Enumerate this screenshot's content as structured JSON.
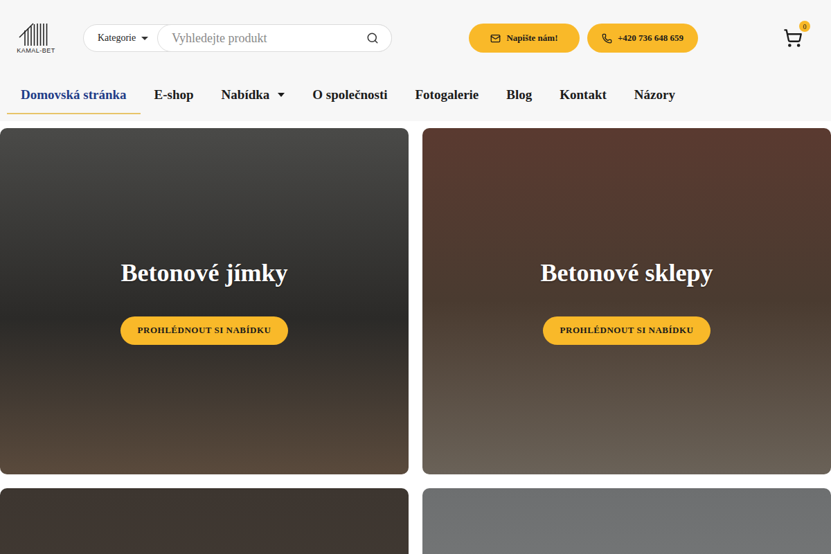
{
  "logo": {
    "text": "KAMAL-BET"
  },
  "search": {
    "category": "Kategorie",
    "placeholder": "Vyhledejte produkt"
  },
  "header_buttons": [
    {
      "label": "Napište nám!",
      "kind": "mail"
    },
    {
      "label": "+420 736 648 659",
      "kind": "phone"
    }
  ],
  "cart": {
    "count": "0"
  },
  "nav": [
    {
      "label": "Domovská stránka",
      "selected": true,
      "dropdown": false
    },
    {
      "label": "E-shop",
      "selected": false,
      "dropdown": false
    },
    {
      "label": "Nabídka",
      "selected": false,
      "dropdown": true
    },
    {
      "label": "O společnosti",
      "selected": false,
      "dropdown": false
    },
    {
      "label": "Fotogalerie",
      "selected": false,
      "dropdown": false
    },
    {
      "label": "Blog",
      "selected": false,
      "dropdown": false
    },
    {
      "label": "Kontakt",
      "selected": false,
      "dropdown": false
    },
    {
      "label": "Názory",
      "selected": false,
      "dropdown": false
    }
  ],
  "cards": [
    {
      "kind": "offer",
      "title": "Betonové jímky",
      "button": "PROHLÉDNOUT SI NABÍDKU"
    },
    {
      "kind": "offer",
      "title": "Betonové sklepy",
      "button": "PROHLÉDNOUT SI NABÍDKU"
    },
    {
      "kind": "photo",
      "title": "",
      "button": ""
    },
    {
      "kind": "photo",
      "title": "",
      "button": ""
    }
  ]
}
